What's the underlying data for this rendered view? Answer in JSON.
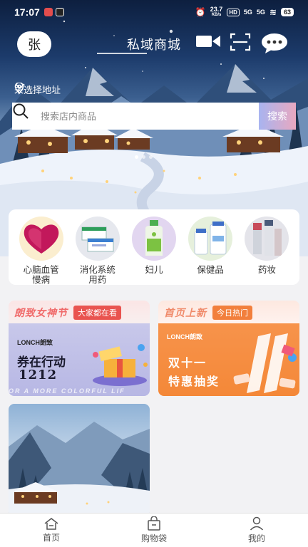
{
  "status_bar": {
    "time": "17:07",
    "net_speed": "23.7",
    "net_unit": "KB/s",
    "hd_badge": "HD",
    "signal_1": "5G",
    "signal_2": "5G",
    "battery": "63"
  },
  "header": {
    "avatar_text": "张",
    "title": "私域商城",
    "icons": [
      "video-icon",
      "scan-icon",
      "chat-icon"
    ]
  },
  "location": {
    "text": "未选择地址"
  },
  "search": {
    "placeholder": "搜索店内商品",
    "button_label": "搜索"
  },
  "categories": [
    {
      "label": "心脑血管\n慢病",
      "icon": "heart-product"
    },
    {
      "label": "消化系统\n用药",
      "icon": "medicine-box"
    },
    {
      "label": "妇儿",
      "icon": "bottle-product"
    },
    {
      "label": "保健品",
      "icon": "supplement-bottles"
    },
    {
      "label": "药妆",
      "icon": "cosmetics"
    }
  ],
  "banners": [
    {
      "head_title": "朗致女神节",
      "tag": "大家都在看",
      "brand": "LONCH朗致",
      "line1": "券在行动",
      "line2": "1212",
      "footline": "OR A MORE COLORFUL LIF"
    },
    {
      "head_title": "首页上新",
      "tag": "今日热门",
      "brand": "LONCH朗致",
      "line1": "双十一",
      "line2": "特惠抽奖"
    }
  ],
  "tabbar": {
    "items": [
      {
        "label": "首页",
        "icon": "home-icon"
      },
      {
        "label": "购物袋",
        "icon": "bag-icon"
      },
      {
        "label": "我的",
        "icon": "user-icon"
      }
    ]
  },
  "colors": {
    "search_button_gradient": [
      "#a8b4f0",
      "#e8a8c0"
    ],
    "tag_red": "#e9534f",
    "tag_orange": "#f27f3c"
  }
}
